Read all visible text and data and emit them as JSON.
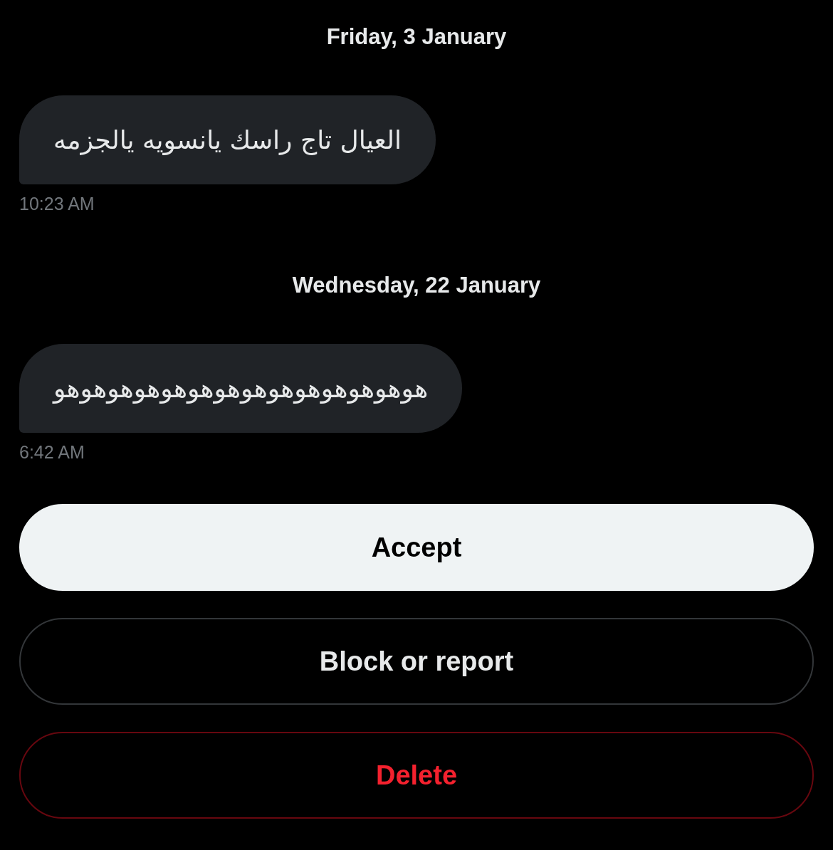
{
  "conversation": [
    {
      "date": "Friday, 3 January",
      "messages": [
        {
          "text": "العيال تاج راسك يانسويه يالجزمه",
          "time": "10:23 AM"
        }
      ]
    },
    {
      "date": "Wednesday, 22 January",
      "messages": [
        {
          "text": "هوهوهوهوهوهوهوهوهوهوهوهوهوهو",
          "time": "6:42 AM"
        }
      ]
    }
  ],
  "actions": [
    {
      "label": "Accept",
      "kind": "primary"
    },
    {
      "label": "Block or report",
      "kind": "outline"
    },
    {
      "label": "Delete",
      "kind": "danger"
    }
  ]
}
